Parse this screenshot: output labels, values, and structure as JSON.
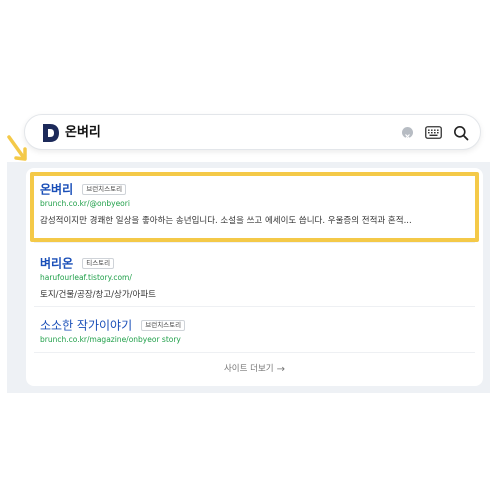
{
  "search": {
    "query": "온벼리"
  },
  "results": [
    {
      "title": "온벼리",
      "badge": "브런치스토리",
      "url": "brunch.co.kr/@onbyeori",
      "snippet": "감성적이지만 경쾌한 일상을 좋아하는 송년입니다. 소설을 쓰고 에세이도 씁니다. 우울증의 전적과 혼적..."
    },
    {
      "title": "벼리온",
      "badge": "티스토리",
      "url": "harufourleaf.tistory.com/",
      "snippet": "토지/건물/공장/창고/상가/아파트"
    },
    {
      "title": "소소한 작가이야기",
      "badge": "브런치스토리",
      "url": "brunch.co.kr/magazine/onbyeor story"
    }
  ],
  "more_link_label": "사이트 더보기",
  "colors": {
    "highlight": "#f4c948",
    "title": "#1a4fb8",
    "url": "#20a04a",
    "panel_bg": "#eef1f5"
  }
}
